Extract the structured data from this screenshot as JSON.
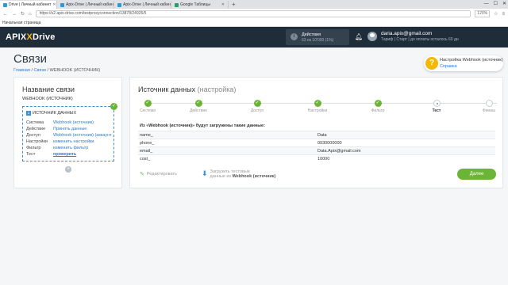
{
  "browser": {
    "tabs": [
      {
        "label": "Drive | Личный кабинет",
        "active": true
      },
      {
        "label": "Apix-Drive | Личный кабинет",
        "active": false
      },
      {
        "label": "Apix-Drive | Личный кабинет",
        "active": false
      },
      {
        "label": "Google Таблицы",
        "active": false
      }
    ],
    "url": "https://s2.apix-drive.com/testproxyconnection/13878/24925/5",
    "zoom": "120%",
    "bookmark": "Начальная страница"
  },
  "header": {
    "logo_text": "APIX",
    "logo_x": "X",
    "logo_drive": "Drive",
    "actions_label": "Действия",
    "actions_count": "63 из 10'000 (1%)",
    "user_email": "daria.apix@gmail.com",
    "plan_text": "Тариф | Старт | до оплаты осталось 60 дн"
  },
  "page": {
    "title": "Связи",
    "breadcrumb": [
      "Главная",
      "Связи",
      "WEBHOOK (ИСТОЧНИК)"
    ],
    "help_label": "Настройка Webhook (источник)",
    "help_link": "Справка"
  },
  "left": {
    "title": "Название связи",
    "subtitle": "WEBHOOK (ИСТОЧНИК)",
    "step_num": "1",
    "step_title": "ИСТОЧНИК ДАННЫХ",
    "rows": [
      {
        "k": "Система",
        "v": "Webhook (источник)"
      },
      {
        "k": "Действие",
        "v": "Принять данные"
      },
      {
        "k": "Доступ",
        "v": "Webhook (источник) (аккаунт"
      },
      {
        "k": "Настройки",
        "v": "изменить настройки"
      },
      {
        "k": "Фильтр",
        "v": "изменить фильтр"
      },
      {
        "k": "Тест",
        "v": "проверить"
      }
    ],
    "add_label": "+"
  },
  "main": {
    "title": "Источник данных",
    "title_suffix": "(настройка)",
    "steps": [
      {
        "label": "Система",
        "state": "done"
      },
      {
        "label": "Действие",
        "state": "done"
      },
      {
        "label": "Доступ",
        "state": "done"
      },
      {
        "label": "Настройки",
        "state": "done"
      },
      {
        "label": "Фильтр",
        "state": "done"
      },
      {
        "label": "Тест",
        "state": "current"
      },
      {
        "label": "Финиш",
        "state": "todo"
      }
    ],
    "load_message": "Из «Webhook (источник)» будут загружены такие данные:",
    "rows": [
      {
        "field": "name_",
        "value": "Data"
      },
      {
        "field": "phone_",
        "value": "0930000000"
      },
      {
        "field": "email_",
        "value": "Data.Apix@gmail.com"
      },
      {
        "field": "cost_",
        "value": "10000"
      }
    ],
    "edit_label": "Редактировать",
    "load_line1": "Загрузить тестовые",
    "load_line2": "данные из",
    "load_source": "Webhook (источник)",
    "next_label": "Далее"
  },
  "colors": {
    "header_bg": "#1f2d3a",
    "accent_green": "#6bb536",
    "link_blue": "#2a7ad6",
    "help_yellow": "#f5b800"
  }
}
